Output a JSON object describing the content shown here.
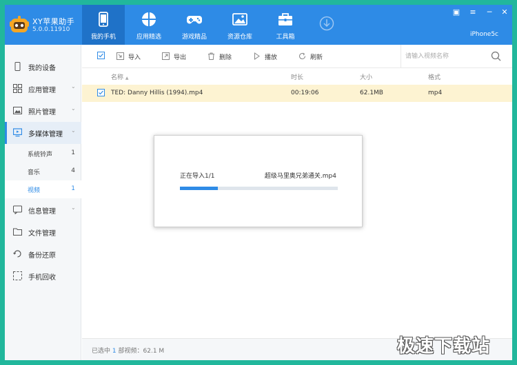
{
  "app": {
    "name": "XY苹果助手",
    "version": "5.0.0.11910",
    "device": "iPhone5c"
  },
  "nav": {
    "tabs": [
      {
        "label": "我的手机",
        "icon": "phone-icon"
      },
      {
        "label": "应用精选",
        "icon": "apps-icon"
      },
      {
        "label": "游戏精品",
        "icon": "gamepad-icon"
      },
      {
        "label": "资源仓库",
        "icon": "image-icon"
      },
      {
        "label": "工具箱",
        "icon": "toolbox-icon"
      }
    ],
    "active": 0
  },
  "window_controls": {
    "skin": "▣",
    "menu": "≡",
    "minimize": "─",
    "close": "✕"
  },
  "sidebar": {
    "items": [
      {
        "label": "我的设备",
        "icon": "device-icon"
      },
      {
        "label": "应用管理",
        "icon": "grid-icon"
      },
      {
        "label": "照片管理",
        "icon": "photo-icon"
      },
      {
        "label": "多媒体管理",
        "icon": "monitor-icon"
      },
      {
        "label": "信息管理",
        "icon": "message-icon"
      },
      {
        "label": "文件管理",
        "icon": "folder-icon"
      },
      {
        "label": "备份还原",
        "icon": "backup-icon"
      },
      {
        "label": "手机回收",
        "icon": "recycle-icon"
      }
    ],
    "sub_items": [
      {
        "label": "系统铃声",
        "count": "1"
      },
      {
        "label": "音乐",
        "count": "4"
      },
      {
        "label": "视频",
        "count": "1"
      }
    ],
    "chevron": "⌄"
  },
  "toolbar": {
    "import_label": "导入",
    "export_label": "导出",
    "delete_label": "删除",
    "play_label": "播放",
    "refresh_label": "刷新",
    "search_placeholder": "请输入视频名称"
  },
  "table": {
    "headers": {
      "name": "名称",
      "sort_arrow": "▲",
      "duration": "时长",
      "size": "大小",
      "format": "格式"
    },
    "rows": [
      {
        "name": "TED: Danny Hillis (1994).mp4",
        "duration": "00:19:06",
        "size": "62.1MB",
        "format": "mp4"
      }
    ]
  },
  "dialog": {
    "status": "正在导入1/1",
    "filename": "超级马里奥兄弟通关.mp4",
    "progress": 0.24
  },
  "footer": {
    "prefix": "已选中",
    "count": "1",
    "suffix": "部视频：62.1 M"
  },
  "watermark": "极速下载站",
  "colors": {
    "accent": "#2e8be6",
    "frame": "#21b79c",
    "selected_row": "#fdf3d2"
  }
}
